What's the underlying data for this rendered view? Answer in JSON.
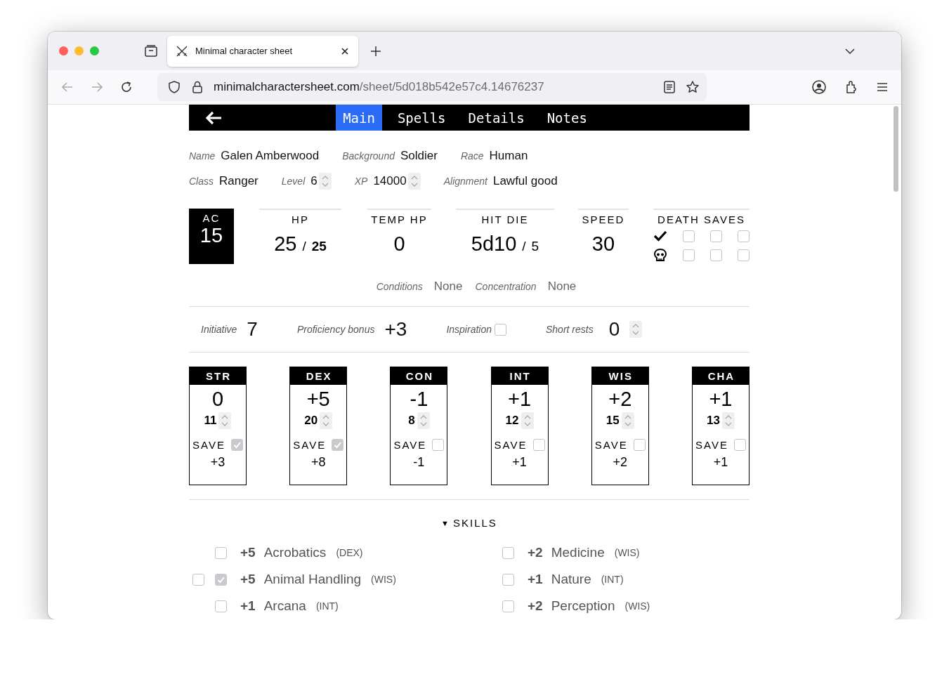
{
  "browser": {
    "tab_title": "Minimal character sheet",
    "url_host": "minimalcharactersheet.com",
    "url_path": "/sheet/5d018b542e57c4.14676237"
  },
  "nav": {
    "tabs": [
      {
        "label": "Main",
        "selected": true
      },
      {
        "label": "Spells",
        "selected": false
      },
      {
        "label": "Details",
        "selected": false
      },
      {
        "label": "Notes",
        "selected": false
      }
    ]
  },
  "identity": [
    {
      "fields": [
        {
          "label": "Name",
          "value": "Galen Amberwood",
          "kind": "text"
        },
        {
          "label": "Background",
          "value": "Soldier",
          "kind": "text"
        },
        {
          "label": "Race",
          "value": "Human",
          "kind": "text"
        }
      ]
    },
    {
      "fields": [
        {
          "label": "Class",
          "value": "Ranger",
          "kind": "text"
        },
        {
          "label": "Level",
          "value": "6",
          "kind": "number"
        },
        {
          "label": "XP",
          "value": "14000",
          "kind": "number"
        },
        {
          "label": "Alignment",
          "value": "Lawful good",
          "kind": "text"
        }
      ]
    }
  ],
  "combat": {
    "ac": {
      "label": "AC",
      "value": "15"
    },
    "hp": {
      "label": "HP",
      "current": "25",
      "separator": "/",
      "max": "25"
    },
    "temp_hp": {
      "label": "TEMP HP",
      "value": "0"
    },
    "hit_die": {
      "label": "HIT DIE",
      "die": "5d10",
      "separator": "/",
      "remaining": "5"
    },
    "speed": {
      "label": "SPEED",
      "value": "30"
    },
    "death_saves": {
      "label": "DEATH SAVES",
      "successes": [
        false,
        false,
        false
      ],
      "failures": [
        false,
        false,
        false
      ]
    }
  },
  "status": [
    {
      "label": "Conditions",
      "value": "None"
    },
    {
      "label": "Concentration",
      "value": "None"
    }
  ],
  "extras": [
    {
      "label": "Initiative",
      "value": "7",
      "kind": "value"
    },
    {
      "label": "Proficiency bonus",
      "value": "+3",
      "kind": "value"
    },
    {
      "label": "Inspiration",
      "kind": "checkbox",
      "checked": false
    },
    {
      "label": "Short rests",
      "value": "0",
      "kind": "number"
    }
  ],
  "abilities": [
    {
      "name": "STR",
      "modifier": "0",
      "score": "11",
      "save_label": "SAVE",
      "save_proficient": true,
      "save": "+3"
    },
    {
      "name": "DEX",
      "modifier": "+5",
      "score": "20",
      "save_label": "SAVE",
      "save_proficient": true,
      "save": "+8"
    },
    {
      "name": "CON",
      "modifier": "-1",
      "score": "8",
      "save_label": "SAVE",
      "save_proficient": false,
      "save": "-1"
    },
    {
      "name": "INT",
      "modifier": "+1",
      "score": "12",
      "save_label": "SAVE",
      "save_proficient": false,
      "save": "+1"
    },
    {
      "name": "WIS",
      "modifier": "+2",
      "score": "15",
      "save_label": "SAVE",
      "save_proficient": false,
      "save": "+2"
    },
    {
      "name": "CHA",
      "modifier": "+1",
      "score": "13",
      "save_label": "SAVE",
      "save_proficient": false,
      "save": "+1"
    }
  ],
  "skills": {
    "toggle": "▼",
    "title": "SKILLS",
    "items": [
      {
        "bonus": "+5",
        "name": "Acrobatics",
        "ability": "(DEX)",
        "proficient": false
      },
      {
        "bonus": "+5",
        "name": "Animal Handling",
        "ability": "(WIS)",
        "proficient": true,
        "expertise": false
      },
      {
        "bonus": "+1",
        "name": "Arcana",
        "ability": "(INT)",
        "proficient": false
      },
      {
        "bonus": "+2",
        "name": "Medicine",
        "ability": "(WIS)",
        "proficient": false
      },
      {
        "bonus": "+1",
        "name": "Nature",
        "ability": "(INT)",
        "proficient": false
      },
      {
        "bonus": "+2",
        "name": "Perception",
        "ability": "(WIS)",
        "proficient": false
      }
    ]
  }
}
